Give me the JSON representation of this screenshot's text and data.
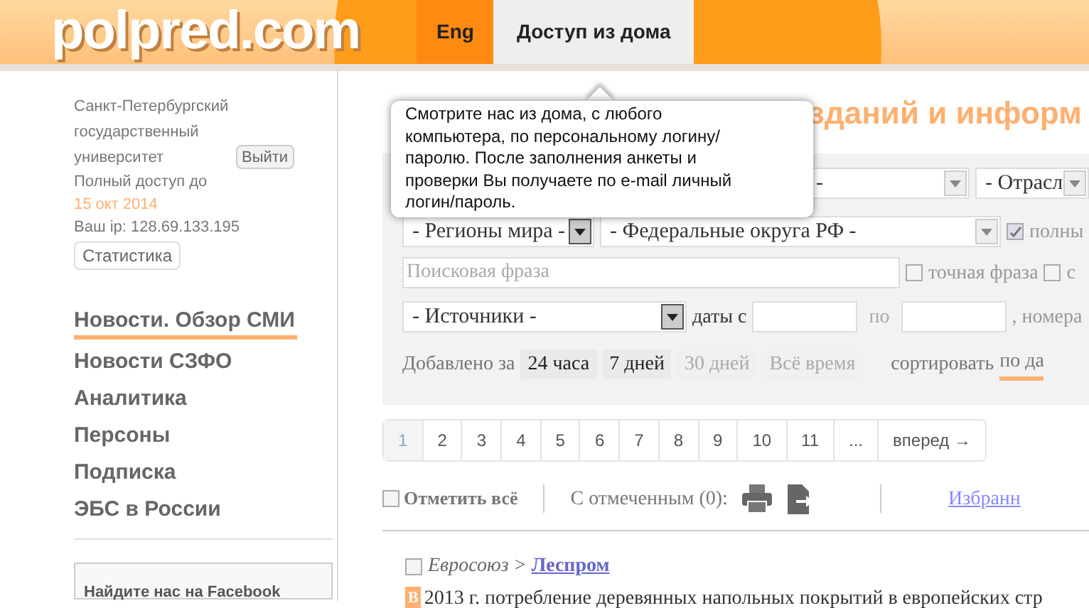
{
  "header": {
    "logo": "polpred.com",
    "tabs": [
      {
        "label": "Eng",
        "selected": false
      },
      {
        "label": "Доступ из дома",
        "selected": true
      }
    ]
  },
  "tooltip": {
    "text": "Смотрите нас из дома, с любого компьютера, по персональному логину/паролю. После заполнения анкеты и проверки Вы получаете по e-mail личный логин/пароль."
  },
  "sidebar": {
    "org": "Санкт-Петербургский государственный университет",
    "logout": "Выйти",
    "access": "Полный доступ до",
    "access_date": "15 окт 2014",
    "ip": "Ваш ip: 128.69.133.195",
    "stats": "Статистика",
    "nav": [
      {
        "label": "Новости. Обзор СМИ",
        "selected": true
      },
      {
        "label": "Новости СЗФО",
        "selected": false
      },
      {
        "label": "Аналитика",
        "selected": false
      },
      {
        "label": "Персоны",
        "selected": false
      },
      {
        "label": "Подписка",
        "selected": false
      },
      {
        "label": "ЭБС в России",
        "selected": false
      }
    ],
    "facebook": "Найдите нас на Facebook"
  },
  "heading": "зданий и информ",
  "filters": {
    "select_1": "-",
    "select_2": "- Отрасл",
    "regions": "- Регионы мира -",
    "districts": "- Федеральные округа РФ -",
    "full_checkbox": {
      "label": "полны",
      "checked": true
    },
    "search_placeholder": "Поисковая фраза",
    "exact_checkbox": {
      "label": "точная фраза",
      "checked": false
    },
    "other_checkbox": {
      "label": "с",
      "checked": false
    },
    "sources": "- Источники -",
    "dates_from": "даты с",
    "dates_to": "по",
    "numbers": ", номера",
    "added_label": "Добавлено за",
    "periods": [
      {
        "label": "24 часа",
        "enabled": true
      },
      {
        "label": "7 дней",
        "enabled": true
      },
      {
        "label": "30 дней",
        "enabled": false
      },
      {
        "label": "Всё время",
        "enabled": false
      }
    ],
    "sort_label": "сортировать",
    "sort_value": "по да"
  },
  "pagination": [
    {
      "label": "1",
      "selected": true
    },
    {
      "label": "2",
      "selected": false
    },
    {
      "label": "3",
      "selected": false
    },
    {
      "label": "4",
      "selected": false
    },
    {
      "label": "5",
      "selected": false
    },
    {
      "label": "6",
      "selected": false
    },
    {
      "label": "7",
      "selected": false
    },
    {
      "label": "8",
      "selected": false
    },
    {
      "label": "9",
      "selected": false
    },
    {
      "label": "10",
      "selected": false
    },
    {
      "label": "11",
      "selected": false
    },
    {
      "label": "...",
      "selected": false
    },
    {
      "label": "вперед →",
      "selected": false
    }
  ],
  "toolbar": {
    "select_all": {
      "label": "Отметить всё",
      "checked": false
    },
    "with_marked": "С отмеченным (0):",
    "favorites": "Избранн"
  },
  "items": [
    {
      "checked": false,
      "category": "Евросоюз",
      "separator": ">",
      "source": "Леспром",
      "badge": "B",
      "text": "2013 г. потребление деревянных напольных покрытий в европейских стр"
    }
  ]
}
